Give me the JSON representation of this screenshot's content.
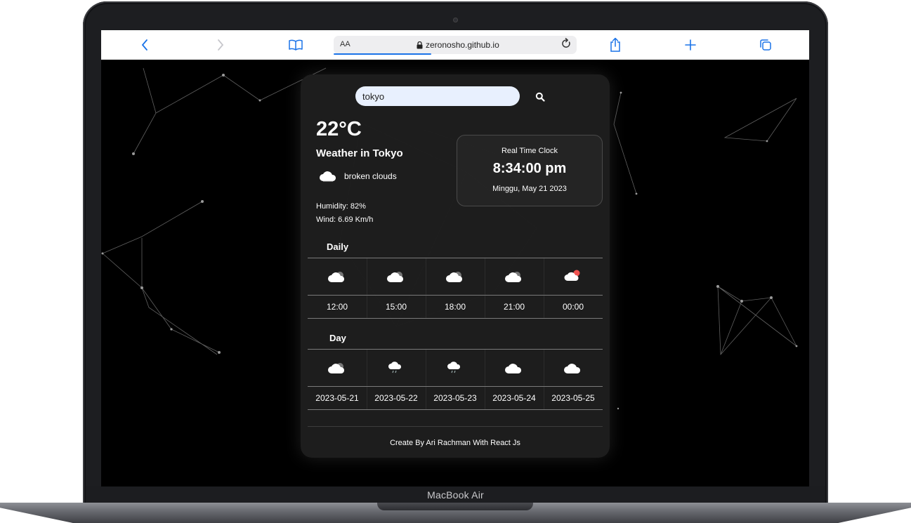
{
  "browser": {
    "aa_label": "AA",
    "url": "zeronosho.github.io"
  },
  "device_label": "MacBook Air",
  "search": {
    "value": "tokyo"
  },
  "current": {
    "temperature": "22°C",
    "city_title": "Weather in Tokyo",
    "description": "broken clouds",
    "humidity": "Humidity: 82%",
    "wind": "Wind: 6.69 Km/h"
  },
  "clock": {
    "title": "Real Time Clock",
    "time": "8:34:00 pm",
    "date": "Minggu, May 21 2023"
  },
  "daily": {
    "title": "Daily",
    "items": [
      {
        "time": "12:00",
        "icon": "cloud-icon"
      },
      {
        "time": "15:00",
        "icon": "cloud-icon"
      },
      {
        "time": "18:00",
        "icon": "cloud-icon"
      },
      {
        "time": "21:00",
        "icon": "cloud-icon"
      },
      {
        "time": "00:00",
        "icon": "cloud-night-icon"
      }
    ]
  },
  "day": {
    "title": "Day",
    "items": [
      {
        "date": "2023-05-21",
        "icon": "cloud-icon"
      },
      {
        "date": "2023-05-22",
        "icon": "cloud-rain-icon"
      },
      {
        "date": "2023-05-23",
        "icon": "cloud-rain-icon"
      },
      {
        "date": "2023-05-24",
        "icon": "cloud-icon"
      },
      {
        "date": "2023-05-25",
        "icon": "cloud-icon"
      }
    ]
  },
  "footer": "Create By Ari Rachman With React Js",
  "colors": {
    "page_bg": "#000000",
    "card_bg": "#1e1e1e",
    "search_bg": "#e8f0fe",
    "safari_accent": "#1a73e8",
    "night_icon_accent": "#ef5350"
  }
}
